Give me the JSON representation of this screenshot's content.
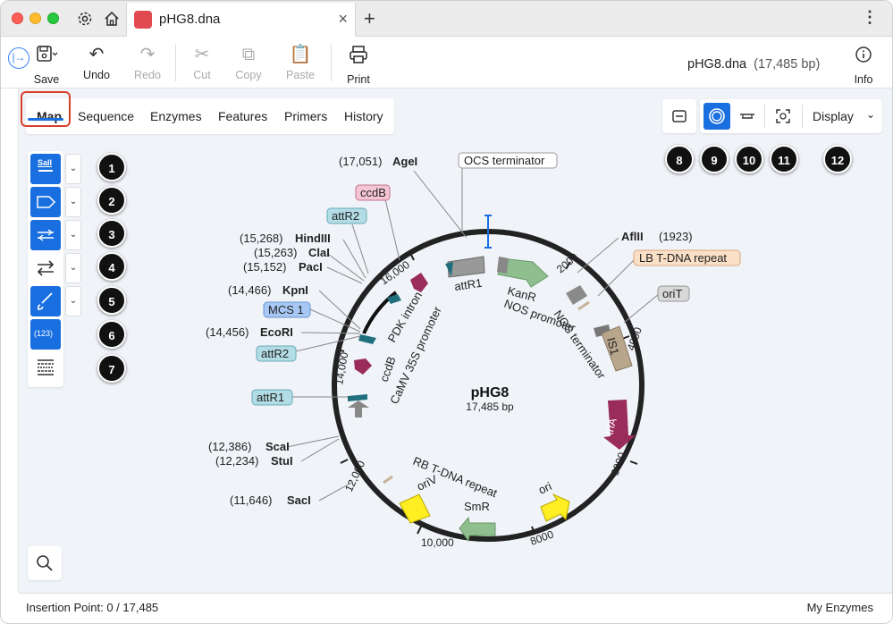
{
  "tab": {
    "title": "pHG8.dna",
    "close": "×",
    "new": "+",
    "more": "⋮"
  },
  "toolbar": {
    "save": "Save",
    "undo": "Undo",
    "redo": "Redo",
    "cut": "Cut",
    "copy": "Copy",
    "paste": "Paste",
    "print": "Print",
    "info": "Info",
    "filename": "pHG8.dna",
    "filesize": "(17,485 bp)"
  },
  "view_tabs": [
    "Map",
    "Sequence",
    "Enzymes",
    "Features",
    "Primers",
    "History"
  ],
  "display": {
    "label": "Display"
  },
  "palette": {
    "sal_label": "SalI",
    "numbers_label": "(123)"
  },
  "badges": [
    "1",
    "2",
    "3",
    "4",
    "5",
    "6",
    "7",
    "8",
    "9",
    "10",
    "11",
    "12"
  ],
  "map": {
    "name": "pHG8",
    "length": "17,485 bp",
    "ticks": [
      "2000",
      "4000",
      "6000",
      "8000",
      "10,000",
      "12,000",
      "14,000",
      "16,000"
    ],
    "enzymes": [
      {
        "pos": "(17,051)",
        "name": "AgeI"
      },
      {
        "pos": "(1923)",
        "name": "AflII"
      },
      {
        "pos": "(15,268)",
        "name": "HindIII"
      },
      {
        "pos": "(15,263)",
        "name": "ClaI"
      },
      {
        "pos": "(15,152)",
        "name": "PacI"
      },
      {
        "pos": "(14,466)",
        "name": "KpnI"
      },
      {
        "pos": "(14,456)",
        "name": "EcoRI"
      },
      {
        "pos": "(12,386)",
        "name": "ScaI"
      },
      {
        "pos": "(12,234)",
        "name": "StuI"
      },
      {
        "pos": "(11,646)",
        "name": "SacI"
      }
    ],
    "boxed_labels": {
      "ocs": "OCS terminator",
      "ccdb": "ccdB",
      "attr2_top": "attR2",
      "mcs": "MCS 1",
      "attr2_mid": "attR2",
      "attr1": "attR1",
      "lb": "LB T-DNA repeat",
      "orit": "oriT"
    },
    "feature_labels": {
      "attr1_in": "attR1",
      "kanr": "KanR",
      "nos_prom": "NOS promoter",
      "nos_term": "NOS terminator",
      "is1": "IS1",
      "trfa": "trfA",
      "pdk": "PDK intron",
      "camv": "CaMV 35S promoter",
      "ccdb_in": "ccdB",
      "rb": "RB T-DNA repeat",
      "oriv": "oriV",
      "smr": "SmR",
      "ori": "ori"
    }
  },
  "status": {
    "insertion": "Insertion Point:  0  /  17,485",
    "enzymes": "My Enzymes"
  },
  "colors": {
    "accent": "#1a6fe0",
    "highlight_outline": "#d9402c"
  }
}
